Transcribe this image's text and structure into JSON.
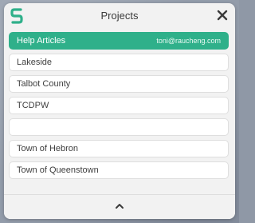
{
  "header": {
    "title": "Projects",
    "logo_icon": "s-logo-icon",
    "close_icon": "close-icon"
  },
  "colors": {
    "accent": "#2fb08a",
    "panel_background": "#f2f2f2",
    "item_background": "#ffffff"
  },
  "projects": [
    {
      "label": "Help Articles",
      "email": "toni@raucheng.com",
      "selected": true
    },
    {
      "label": "Lakeside"
    },
    {
      "label": "Talbot County"
    },
    {
      "label": "TCDPW"
    },
    {
      "label": ""
    },
    {
      "label": "Town of Hebron"
    },
    {
      "label": "Town of Queenstown"
    }
  ],
  "footer": {
    "scroll_icon": "chevron-up-icon"
  }
}
